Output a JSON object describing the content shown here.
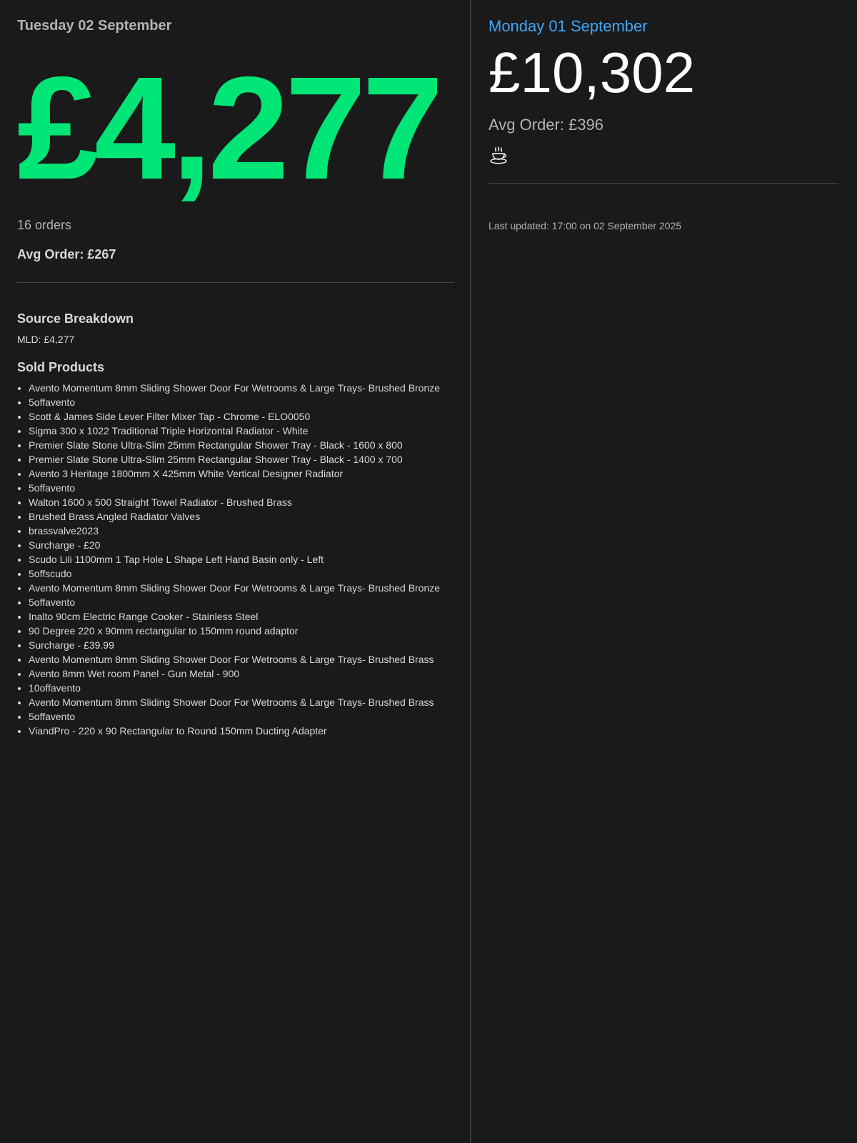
{
  "today": {
    "date": "Tuesday 02 September",
    "total": "£4,277",
    "orders": "16 orders",
    "avg_order": "Avg Order: £267",
    "source_breakdown_title": "Source Breakdown",
    "source_lines": [
      "MLD: £4,277"
    ],
    "sold_products_title": "Sold Products",
    "products": [
      "Avento Momentum 8mm Sliding Shower Door For Wetrooms & Large Trays- Brushed Bronze",
      "5offavento",
      "Scott & James Side Lever Filter Mixer Tap - Chrome - ELO0050",
      "Sigma 300 x 1022 Traditional Triple Horizontal Radiator - White",
      "Premier Slate Stone Ultra-Slim 25mm Rectangular Shower Tray - Black - 1600 x 800",
      "Premier Slate Stone Ultra-Slim 25mm Rectangular Shower Tray - Black - 1400 x 700",
      "Avento 3 Heritage 1800mm X 425mm White Vertical Designer Radiator",
      "5offavento",
      "Walton 1600 x 500 Straight Towel Radiator - Brushed Brass",
      "Brushed Brass Angled Radiator Valves",
      "brassvalve2023",
      "Surcharge - £20",
      "Scudo Lili 1100mm 1 Tap Hole L Shape Left Hand Basin only - Left",
      "5offscudo",
      "Avento Momentum 8mm Sliding Shower Door For Wetrooms & Large Trays- Brushed Bronze",
      "5offavento",
      "Inalto 90cm Electric Range Cooker - Stainless Steel",
      "90 Degree 220 x 90mm rectangular to 150mm round adaptor",
      "Surcharge - £39.99",
      "Avento Momentum 8mm Sliding Shower Door For Wetrooms & Large Trays- Brushed Brass",
      "Avento 8mm Wet room Panel - Gun Metal - 900",
      "10offavento",
      "Avento Momentum 8mm Sliding Shower Door For Wetrooms & Large Trays- Brushed Brass",
      "5offavento",
      "ViandPro - 220 x 90 Rectangular to Round 150mm Ducting Adapter"
    ]
  },
  "yesterday": {
    "date": "Monday 01 September",
    "total": "£10,302",
    "avg_order": "Avg Order: £396",
    "icon": "coffee-icon"
  },
  "last_updated": "Last updated: 17:00 on 02 September 2025",
  "colors": {
    "background": "#1a1a1a",
    "today_total": "#00e676",
    "yesterday_date": "#42a5f5",
    "muted_text": "#b3b3b3",
    "text": "#d9d9d9"
  }
}
